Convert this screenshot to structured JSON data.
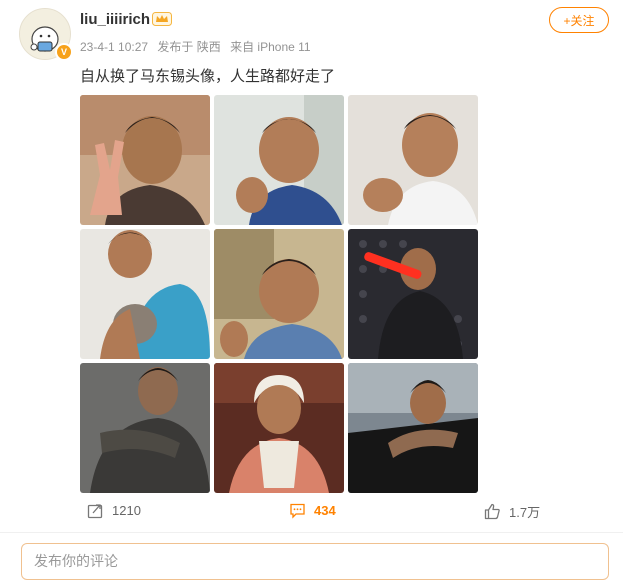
{
  "post": {
    "username": "liu_iiiirich",
    "verified_badge": "V",
    "timestamp": "23-4-1 10:27",
    "location": "发布于 陕西",
    "device": "来自 iPhone 11",
    "follow_label": "+关注",
    "text": "自从换了马东锡头像，人生路都好走了"
  },
  "photos": [
    {
      "icon": "photo-peace-sign"
    },
    {
      "icon": "photo-finger-heart"
    },
    {
      "icon": "photo-fist-smile"
    },
    {
      "icon": "photo-holding-cat"
    },
    {
      "icon": "photo-thumbs-up"
    },
    {
      "icon": "photo-lightsaber"
    },
    {
      "icon": "photo-tattoo-arm"
    },
    {
      "icon": "photo-bib-costume"
    },
    {
      "icon": "photo-car-window"
    }
  ],
  "actions": {
    "repost_count": "1210",
    "comment_count": "434",
    "like_count": "1.7万"
  },
  "comment_box": {
    "placeholder": "发布你的评论"
  },
  "colors": {
    "accent": "#ff8200",
    "meta_text": "#939393",
    "badge": "#f7a21b"
  }
}
